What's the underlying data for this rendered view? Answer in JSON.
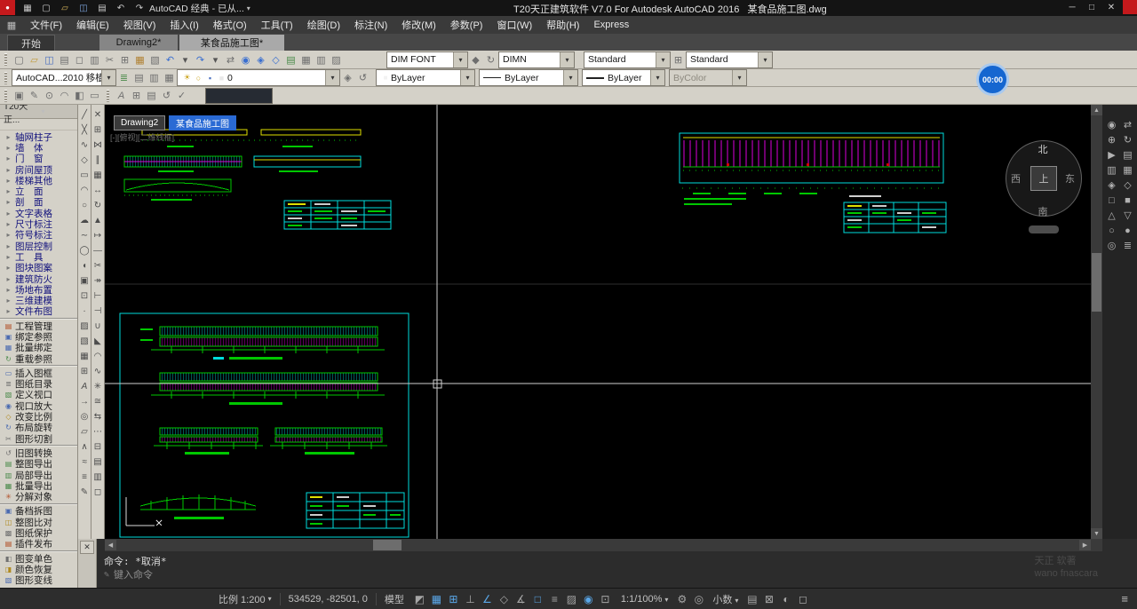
{
  "colors": {
    "cad-cyan": "#00dcdc",
    "cad-green": "#00c800",
    "cad-magenta": "#dc00dc",
    "cad-yellow": "#e0e000",
    "cad-red": "#d40000",
    "cad-white": "#d8d8d8",
    "crosshair": "#cfcfcf",
    "status-active": "#5aa7e8"
  },
  "titlebar": {
    "record_glyph": "●",
    "qat_icons": [
      {
        "n": "app-menu-icon",
        "g": "▦",
        "c": "#c9c9c9"
      },
      {
        "n": "qnew-icon",
        "g": "▢",
        "c": "#c9c9c9"
      },
      {
        "n": "open-icon",
        "g": "▱",
        "c": "#d4b25a"
      },
      {
        "n": "save-icon",
        "g": "◫",
        "c": "#7fa7e0"
      },
      {
        "n": "plot-icon",
        "g": "▤",
        "c": "#c9c9c9"
      },
      {
        "n": "undo-icon",
        "g": "↶",
        "c": "#c9c9c9"
      },
      {
        "n": "redo-icon",
        "g": "↷",
        "c": "#c9c9c9"
      }
    ],
    "workspace_label": "AutoCAD 经典 - 已从...",
    "title": "T20天正建筑软件 V7.0 For Autodesk AutoCAD 2016   某食品施工图.dwg",
    "minimize": "─",
    "maximize": "□",
    "close": "✕"
  },
  "timer": {
    "value": "00:00"
  },
  "menubar": {
    "lead_icon": "▦",
    "items": [
      "文件(F)",
      "编辑(E)",
      "视图(V)",
      "插入(I)",
      "格式(O)",
      "工具(T)",
      "绘图(D)",
      "标注(N)",
      "修改(M)",
      "参数(P)",
      "窗口(W)",
      "帮助(H)",
      "Express"
    ]
  },
  "ribbon": {
    "start": "开始",
    "tab2": "Drawing2*",
    "tab3": "某食品施工图*"
  },
  "toolbar1": {
    "icons": [
      {
        "n": "qnew-icon",
        "g": "▢",
        "c": "#6e6e6e"
      },
      {
        "n": "open-icon",
        "g": "▱",
        "c": "#c09a3a"
      },
      {
        "n": "save-icon",
        "g": "◫",
        "c": "#4a6fc0"
      },
      {
        "n": "plot-icon",
        "g": "▤",
        "c": "#6e6e6e"
      },
      {
        "n": "plot-preview-icon",
        "g": "◻",
        "c": "#6e6e6e"
      },
      {
        "n": "publish-icon",
        "g": "▥",
        "c": "#6e6e6e"
      },
      {
        "n": "cut-icon",
        "g": "✂",
        "c": "#6e6e6e"
      },
      {
        "n": "copy-icon",
        "g": "⊞",
        "c": "#6e6e6e"
      },
      {
        "n": "paste-icon",
        "g": "▦",
        "c": "#b08030"
      },
      {
        "n": "match-properties-icon",
        "g": "▧",
        "c": "#6e6e6e"
      },
      {
        "n": "undo-icon",
        "g": "↶",
        "c": "#3a6fd0"
      },
      {
        "n": "undo-caret-icon",
        "g": "▾",
        "c": "#555555"
      },
      {
        "n": "redo-icon",
        "g": "↷",
        "c": "#3a6fd0"
      },
      {
        "n": "redo-caret-icon",
        "g": "▾",
        "c": "#555555"
      },
      {
        "n": "pan-icon",
        "g": "⇄",
        "c": "#6e6e6e"
      },
      {
        "n": "zoom-realtime-icon",
        "g": "◉",
        "c": "#3a6fd0"
      },
      {
        "n": "zoom-window-icon",
        "g": "◈",
        "c": "#3a6fd0"
      },
      {
        "n": "zoom-previous-icon",
        "g": "◇",
        "c": "#3a6fd0"
      },
      {
        "n": "properties-icon",
        "g": "▤",
        "c": "#4a8a4a"
      },
      {
        "n": "designcenter-icon",
        "g": "▦",
        "c": "#6e6e6e"
      },
      {
        "n": "tool-palettes-icon",
        "g": "▥",
        "c": "#6e6e6e"
      },
      {
        "n": "sheet-set-manager-icon",
        "g": "▨",
        "c": "#6e6e6e"
      }
    ],
    "dim_font_combo": "DIM FONT",
    "icons_b": [
      {
        "n": "dim-style-icon",
        "g": "◆",
        "c": "#6e6e6e"
      },
      {
        "n": "dim-update-icon",
        "g": "↻",
        "c": "#6e6e6e"
      }
    ],
    "dimn_combo": "DIMN",
    "text_style_combo": "Standard",
    "icons_c": [
      {
        "n": "table-style-icon",
        "g": "⊞",
        "c": "#6e6e6e"
      }
    ],
    "table_style_combo": "Standard"
  },
  "toolbar2": {
    "workspace_combo": "AutoCAD...2010 移植",
    "icons_a": [
      {
        "n": "layer-properties-icon",
        "g": "≣",
        "c": "#4a8a4a"
      },
      {
        "n": "layer-states-icon",
        "g": "▤",
        "c": "#6e6e6e"
      },
      {
        "n": "layer-isolate-icon",
        "g": "▥",
        "c": "#6e6e6e"
      },
      {
        "n": "layer-freeze-icon",
        "g": "▦",
        "c": "#6e6e6e"
      }
    ],
    "layer_status_icons": [
      {
        "n": "layer-on-icon",
        "g": "☀",
        "c": "#caa21a"
      },
      {
        "n": "layer-thaw-icon",
        "g": "○",
        "c": "#caa21a"
      },
      {
        "n": "layer-unlock-icon",
        "g": "▪",
        "c": "#4a6fc0"
      },
      {
        "n": "layer-color-swatch",
        "g": "■",
        "c": "#e8e8e8"
      }
    ],
    "layer_name": "0",
    "icons_b": [
      {
        "n": "make-object-layer-current-icon",
        "g": "◈",
        "c": "#6e6e6e"
      },
      {
        "n": "layer-previous-icon",
        "g": "↺",
        "c": "#6e6e6e"
      }
    ],
    "color_combo": "ByLayer",
    "linetype_combo": "ByLayer",
    "lineweight_combo": "ByLayer",
    "plotstyle_combo": "ByColor"
  },
  "toolbar3": {
    "icons_a": [
      {
        "n": "insert-block-icon",
        "g": "▣",
        "c": "#6e6e6e"
      },
      {
        "n": "block-editor-icon",
        "g": "✎",
        "c": "#6e6e6e"
      },
      {
        "n": "attach-reference-icon",
        "g": "⊙",
        "c": "#6e6e6e"
      },
      {
        "n": "clip-icon",
        "g": "◠",
        "c": "#6e6e6e"
      },
      {
        "n": "adjust-icon",
        "g": "◧",
        "c": "#6e6e6e"
      },
      {
        "n": "frame-icon",
        "g": "▭",
        "c": "#6e6e6e"
      }
    ],
    "icons_b": [
      {
        "n": "text-icon",
        "g": "A",
        "c": "#6e6e6e"
      },
      {
        "n": "table-icon",
        "g": "⊞",
        "c": "#6e6e6e"
      },
      {
        "n": "field-icon",
        "g": "▤",
        "c": "#6e6e6e"
      },
      {
        "n": "update-icon",
        "g": "↺",
        "c": "#6e6e6e"
      },
      {
        "n": "spell-check-icon",
        "g": "✓",
        "c": "#6e6e6e"
      }
    ],
    "field_value": ""
  },
  "palette": {
    "title": "T20天正...",
    "g1": [
      {
        "label": "轴网柱子",
        "g": "▸",
        "c": "#777777"
      },
      {
        "label": "墙　体",
        "g": "▸",
        "c": "#777777"
      },
      {
        "label": "门　窗",
        "g": "▸",
        "c": "#777777"
      },
      {
        "label": "房间屋顶",
        "g": "▸",
        "c": "#777777"
      },
      {
        "label": "楼梯其他",
        "g": "▸",
        "c": "#777777"
      },
      {
        "label": "立　面",
        "g": "▸",
        "c": "#777777"
      },
      {
        "label": "剖　面",
        "g": "▸",
        "c": "#777777"
      },
      {
        "label": "文字表格",
        "g": "▸",
        "c": "#777777"
      },
      {
        "label": "尺寸标注",
        "g": "▸",
        "c": "#777777"
      },
      {
        "label": "符号标注",
        "g": "▸",
        "c": "#777777"
      },
      {
        "label": "图层控制",
        "g": "▸",
        "c": "#777777"
      },
      {
        "label": "工　具",
        "g": "▸",
        "c": "#777777"
      },
      {
        "label": "图块图案",
        "g": "▸",
        "c": "#777777"
      },
      {
        "label": "建筑防火",
        "g": "▸",
        "c": "#777777"
      },
      {
        "label": "场地布置",
        "g": "▸",
        "c": "#777777"
      },
      {
        "label": "三维建模",
        "g": "▸",
        "c": "#777777"
      },
      {
        "label": "文件布图",
        "g": "▸",
        "c": "#777777"
      }
    ],
    "g2": [
      {
        "label": "工程管理",
        "g": "▤",
        "c": "#b04a20"
      },
      {
        "label": "绑定参照",
        "g": "▣",
        "c": "#4a6ab0"
      },
      {
        "label": "批量绑定",
        "g": "▦",
        "c": "#4a6ab0"
      },
      {
        "label": "重载参照",
        "g": "↻",
        "c": "#4a8a4a"
      }
    ],
    "g3": [
      {
        "label": "插入图框",
        "g": "▭",
        "c": "#4a6ab0"
      },
      {
        "label": "图纸目录",
        "g": "≣",
        "c": "#707070"
      },
      {
        "label": "定义视口",
        "g": "▧",
        "c": "#4a8a4a"
      },
      {
        "label": "视口放大",
        "g": "◉",
        "c": "#4a6ab0"
      },
      {
        "label": "改变比例",
        "g": "◇",
        "c": "#b08a20"
      },
      {
        "label": "布局旋转",
        "g": "↻",
        "c": "#4a6ab0"
      },
      {
        "label": "图形切割",
        "g": "✂",
        "c": "#707070"
      }
    ],
    "g4": [
      {
        "label": "旧图转换",
        "g": "↺",
        "c": "#707070"
      },
      {
        "label": "整图导出",
        "g": "▤",
        "c": "#4a8a4a"
      },
      {
        "label": "局部导出",
        "g": "▥",
        "c": "#4a8a4a"
      },
      {
        "label": "批量导出",
        "g": "▦",
        "c": "#4a8a4a"
      },
      {
        "label": "分解对象",
        "g": "✳",
        "c": "#b04a20"
      }
    ],
    "g5": [
      {
        "label": "备档拆图",
        "g": "▣",
        "c": "#4a6ab0"
      },
      {
        "label": "整图比对",
        "g": "◫",
        "c": "#b08a20"
      },
      {
        "label": "图纸保护",
        "g": "▩",
        "c": "#707070"
      },
      {
        "label": "插件发布",
        "g": "▤",
        "c": "#b04a20"
      }
    ],
    "g6": [
      {
        "label": "图变单色",
        "g": "◧",
        "c": "#707070"
      },
      {
        "label": "颜色恢复",
        "g": "◨",
        "c": "#b08a20"
      },
      {
        "label": "图形变线",
        "g": "▧",
        "c": "#4a6ab0"
      }
    ]
  },
  "draw_toolbar": {
    "icons": [
      {
        "n": "line-icon",
        "g": "╱"
      },
      {
        "n": "construction-line-icon",
        "g": "╳"
      },
      {
        "n": "polyline-icon",
        "g": "∿"
      },
      {
        "n": "polygon-icon",
        "g": "◇"
      },
      {
        "n": "rectangle-icon",
        "g": "▭"
      },
      {
        "n": "arc-icon",
        "g": "◠"
      },
      {
        "n": "circle-icon",
        "g": "○"
      },
      {
        "n": "revision-cloud-icon",
        "g": "☁"
      },
      {
        "n": "spline-icon",
        "g": "∼"
      },
      {
        "n": "ellipse-icon",
        "g": "◯"
      },
      {
        "n": "ellipse-arc-icon",
        "g": "◖"
      },
      {
        "n": "insert-block-icon",
        "g": "▣"
      },
      {
        "n": "make-block-icon",
        "g": "⊡"
      },
      {
        "n": "point-icon",
        "g": "·"
      },
      {
        "n": "hatch-icon",
        "g": "▨"
      },
      {
        "n": "gradient-icon",
        "g": "▧"
      },
      {
        "n": "region-icon",
        "g": "▦"
      },
      {
        "n": "table-icon",
        "g": "⊞"
      },
      {
        "n": "mtext-icon",
        "g": "A"
      },
      {
        "n": "ray-icon",
        "g": "→"
      },
      {
        "n": "donut-icon",
        "g": "◎"
      },
      {
        "n": "wipeout-icon",
        "g": "▱"
      },
      {
        "n": "polyline-3d-icon",
        "g": "∧"
      },
      {
        "n": "helix-icon",
        "g": "≈"
      },
      {
        "n": "multiline-icon",
        "g": "≡"
      },
      {
        "n": "sketch-icon",
        "g": "✎"
      }
    ]
  },
  "modify_toolbar": {
    "icons": [
      {
        "n": "erase-icon",
        "g": "✕"
      },
      {
        "n": "copy-icon",
        "g": "⊞"
      },
      {
        "n": "mirror-icon",
        "g": "⋈"
      },
      {
        "n": "offset-icon",
        "g": "∥"
      },
      {
        "n": "array-icon",
        "g": "▦"
      },
      {
        "n": "move-icon",
        "g": "↔"
      },
      {
        "n": "rotate-icon",
        "g": "↻"
      },
      {
        "n": "scale-icon",
        "g": "▲"
      },
      {
        "n": "stretch-icon",
        "g": "↦"
      },
      {
        "n": "lengthen-icon",
        "g": "—"
      },
      {
        "n": "trim-icon",
        "g": "✂"
      },
      {
        "n": "extend-icon",
        "g": "↠"
      },
      {
        "n": "break-at-point-icon",
        "g": "⊢"
      },
      {
        "n": "break-icon",
        "g": "⊣"
      },
      {
        "n": "join-icon",
        "g": "∪"
      },
      {
        "n": "chamfer-icon",
        "g": "◣"
      },
      {
        "n": "fillet-icon",
        "g": "◠"
      },
      {
        "n": "blend-icon",
        "g": "∿"
      },
      {
        "n": "explode-icon",
        "g": "✳"
      },
      {
        "n": "align-icon",
        "g": "≅"
      },
      {
        "n": "reverse-icon",
        "g": "⇆"
      },
      {
        "n": "array-path-icon",
        "g": "⋯"
      },
      {
        "n": "copy-nested-icon",
        "g": "⊟"
      },
      {
        "n": "set-bylayer-icon",
        "g": "▤"
      },
      {
        "n": "match-layer-icon",
        "g": "▥"
      },
      {
        "n": "group-icon",
        "g": "◻"
      }
    ]
  },
  "drawing": {
    "tab1": "Drawing2",
    "tab2": "某食品施工图",
    "viewport_label": "[-][俯视][二维线框]"
  },
  "compass": {
    "north": "北",
    "south": "南",
    "west": "西",
    "east": "东",
    "up": "上"
  },
  "right_panel": {
    "icons": [
      {
        "n": "full-navigation-wheel-icon",
        "g": "◉"
      },
      {
        "n": "pan-icon",
        "g": "⇄"
      },
      {
        "n": "zoom-icon",
        "g": "⊕"
      },
      {
        "n": "orbit-icon",
        "g": "↻"
      },
      {
        "n": "showmotion-icon",
        "g": "▶"
      },
      {
        "n": "view-top-icon",
        "g": "▤"
      },
      {
        "n": "view-front-icon",
        "g": "▥"
      },
      {
        "n": "view-side-icon",
        "g": "▦"
      },
      {
        "n": "view-iso-icon",
        "g": "◈"
      },
      {
        "n": "view-previous-icon",
        "g": "◇"
      },
      {
        "n": "ucs-icon",
        "g": "□"
      },
      {
        "n": "grid-display-icon",
        "g": "■"
      },
      {
        "n": "nav-up-icon",
        "g": "△"
      },
      {
        "n": "nav-down-icon",
        "g": "▽"
      },
      {
        "n": "circle-tool-icon",
        "g": "○"
      },
      {
        "n": "point-tool-icon",
        "g": "●"
      },
      {
        "n": "target-icon",
        "g": "◎"
      },
      {
        "n": "list-icon",
        "g": "≣"
      }
    ]
  },
  "command": {
    "close": "✕",
    "history": "命令: *取消*",
    "prompt_icon": "✎",
    "prompt": "键入命令",
    "watermark1": "天正 软著",
    "watermark2": "wano fnascara"
  },
  "statusbar": {
    "scale_label": "比例 1:200",
    "coords": "534529, -82501, 0",
    "space_label": "模型",
    "icons_a": [
      {
        "n": "infer-constraints-icon",
        "g": "◩",
        "c": "#a6a6a6"
      },
      {
        "n": "snap-icon",
        "g": "▦",
        "c": "#5aa7e8"
      },
      {
        "n": "grid-icon",
        "g": "⊞",
        "c": "#5aa7e8"
      },
      {
        "n": "ortho-icon",
        "g": "⊥",
        "c": "#a6a6a6"
      },
      {
        "n": "polar-tracking-icon",
        "g": "∠",
        "c": "#5aa7e8"
      },
      {
        "n": "isodraft-icon",
        "g": "◇",
        "c": "#a6a6a6"
      },
      {
        "n": "osnap-tracking-icon",
        "g": "∡",
        "c": "#a6a6a6"
      },
      {
        "n": "osnap-icon",
        "g": "□",
        "c": "#5aa7e8"
      },
      {
        "n": "lineweight-icon",
        "g": "≡",
        "c": "#a6a6a6"
      },
      {
        "n": "transparency-icon",
        "g": "▨",
        "c": "#a6a6a6"
      },
      {
        "n": "selection-cycling-icon",
        "g": "◉",
        "c": "#5aa7e8"
      },
      {
        "n": "dynamic-ucs-icon",
        "g": "⊡",
        "c": "#a6a6a6"
      }
    ],
    "zoom_label": "1:1/100%",
    "icons_b": [
      {
        "n": "workspace-switch-icon",
        "g": "⚙",
        "c": "#a6a6a6"
      },
      {
        "n": "annotation-monitor-icon",
        "g": "◎",
        "c": "#a6a6a6"
      }
    ],
    "units_label": "小数",
    "icons_c": [
      {
        "n": "quick-properties-icon",
        "g": "▤",
        "c": "#a6a6a6"
      },
      {
        "n": "ui-lock-icon",
        "g": "⊠",
        "c": "#a6a6a6"
      },
      {
        "n": "isolate-objects-icon",
        "g": "◐",
        "c": "#a6a6a6"
      },
      {
        "n": "clean-screen-icon",
        "g": "◻",
        "c": "#a6a6a6"
      }
    ],
    "menu_icon": "≡"
  }
}
